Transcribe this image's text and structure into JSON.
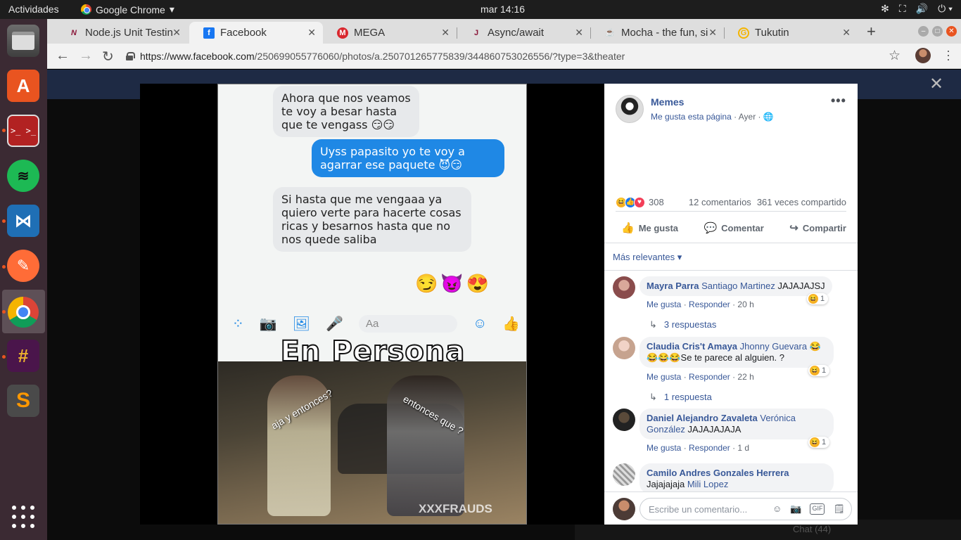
{
  "topbar": {
    "activities": "Actividades",
    "app_name": "Google Chrome",
    "clock": "mar 14:16"
  },
  "dock": {
    "apps": [
      "files-app",
      "ubuntu-software",
      "terminal-app",
      "spotify",
      "vscode",
      "postman",
      "google-chrome",
      "slack",
      "sublime-text"
    ]
  },
  "tabs": [
    {
      "title": "Node.js Unit Testin",
      "icon": "N",
      "color": "#8a1538"
    },
    {
      "title": "Facebook",
      "icon": "f",
      "color": "#1877f2"
    },
    {
      "title": "MEGA",
      "icon": "M",
      "color": "#d9272e"
    },
    {
      "title": "Async/await",
      "icon": "J",
      "color": "#8a1538"
    },
    {
      "title": "Mocha - the fun, si",
      "icon": "☕",
      "color": "#8d6e63"
    },
    {
      "title": "Tukutin",
      "icon": "G",
      "color": "#f4b400"
    }
  ],
  "address": {
    "host": "https://www.facebook.com",
    "path": "/250699055776060/photos/a.250701265775839/344860753026556/?type=3&theater"
  },
  "meme": {
    "bubble1": "Ahora que nos veamos te voy a besar hasta que te vengass 😏😏",
    "bubble2": "Uyss papasito yo te voy a agarrar ese paquete 😈😏",
    "bubble3": "Si hasta que me vengaaa ya quiero verte para hacerte cosas ricas y besarnos hasta que no nos quede saliba",
    "reactions": "😏😈😍",
    "input_placeholder": "Aa",
    "title": "En Persona",
    "caption1": "aja y entonces?",
    "caption2": "entonces que ?",
    "watermark": "XXXFRAUDS"
  },
  "post": {
    "page_name": "Memes",
    "like_page": "Me gusta esta página",
    "time": "· Ayer ·",
    "reaction_count": "308",
    "comments_count": "12 comentarios",
    "shares_count": "361 veces compartido",
    "action_like": "Me gusta",
    "action_comment": "Comentar",
    "action_share": "Compartir",
    "sort_label": "Más relevantes ▾"
  },
  "comments": [
    {
      "author": "Mayra Parra",
      "mention": "Santiago Martinez",
      "text": " JAJAJAJSJ",
      "time": "20 h",
      "react_count": "1",
      "replies": "3 respuestas"
    },
    {
      "author": "Claudia Cris't Amaya",
      "mention": "Jhonny Guevara",
      "text": "😂😂😂😂Se te parece al alguien. ?",
      "time": "22 h",
      "react_count": "1",
      "replies": "1 respuesta"
    },
    {
      "author": "Daniel Alejandro Zavaleta",
      "mention": "Verónica González",
      "text": " JAJAJAJAJA",
      "time": "1 d",
      "react_count": "1"
    },
    {
      "author": "Camilo Andres Gonzales Herrera",
      "mention": "Mili Lopez",
      "text": "Jajajajaja "
    }
  ],
  "comment_links": {
    "like": "Me gusta",
    "reply": "Responder"
  },
  "composer": {
    "placeholder": "Escribe un comentario..."
  },
  "chat_label": "Chat (44)"
}
